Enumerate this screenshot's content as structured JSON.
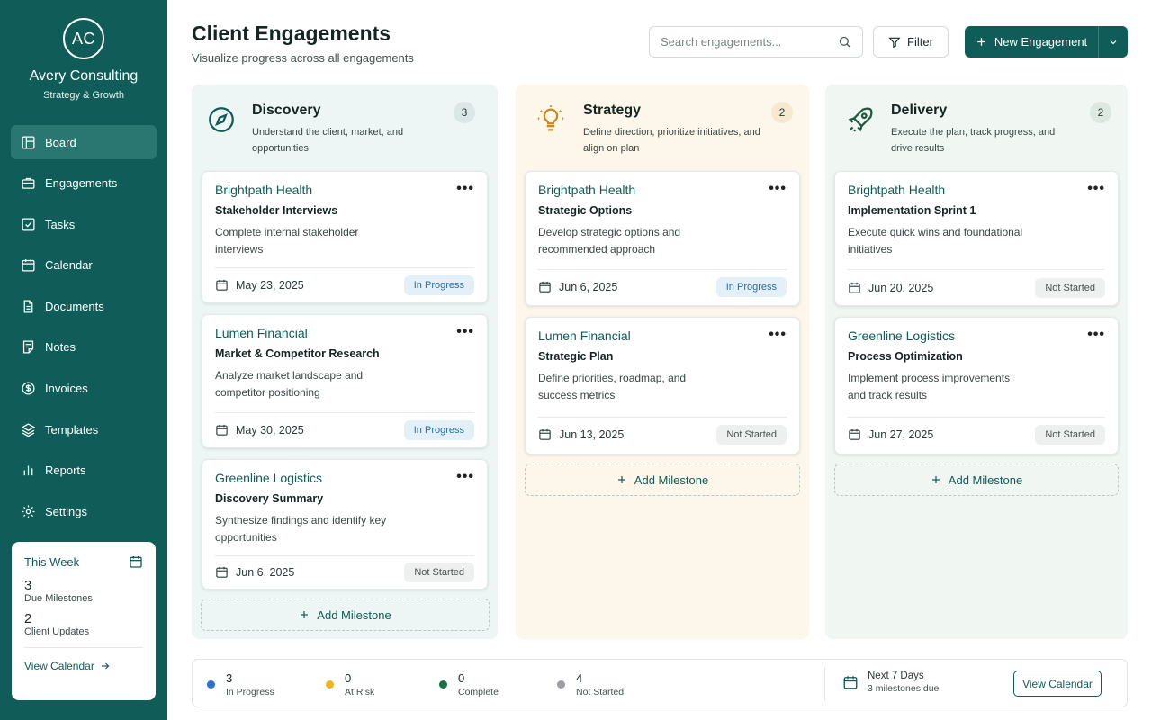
{
  "brand": {
    "initials": "AC",
    "name": "Avery Consulting",
    "tagline": "Strategy & Growth"
  },
  "nav": [
    {
      "label": "Board",
      "icon": "board-icon",
      "active": true
    },
    {
      "label": "Engagements",
      "icon": "briefcase-icon"
    },
    {
      "label": "Tasks",
      "icon": "checkbox-icon"
    },
    {
      "label": "Calendar",
      "icon": "calendar-icon"
    },
    {
      "label": "Documents",
      "icon": "document-icon"
    },
    {
      "label": "Notes",
      "icon": "notes-icon"
    },
    {
      "label": "Invoices",
      "icon": "dollar-icon"
    },
    {
      "label": "Templates",
      "icon": "layers-icon"
    },
    {
      "label": "Reports",
      "icon": "bar-chart-icon"
    },
    {
      "label": "Settings",
      "icon": "gear-icon"
    }
  ],
  "week": {
    "title": "This Week",
    "due_count": "3",
    "due_label": "Due Milestones",
    "updates_count": "2",
    "updates_label": "Client Updates",
    "link": "View Calendar"
  },
  "header": {
    "title": "Client Engagements",
    "subtitle": "Visualize progress across all engagements",
    "search_placeholder": "Search engagements...",
    "filter_label": "Filter",
    "new_label": "New Engagement"
  },
  "columns": {
    "discovery": {
      "title": "Discovery",
      "desc": "Understand the client, market, and opportunities",
      "count": "3",
      "icon": "compass-icon",
      "cards": [
        {
          "client": "Brightpath Health",
          "title": "Stakeholder Interviews",
          "desc": "Complete internal stakeholder interviews",
          "date": "May 23, 2025",
          "status": "In Progress"
        },
        {
          "client": "Lumen Financial",
          "title": "Market & Competitor Research",
          "desc": "Analyze market landscape and competitor positioning",
          "date": "May 30, 2025",
          "status": "In Progress"
        },
        {
          "client": "Greenline Logistics",
          "title": "Discovery Summary",
          "desc": "Synthesize findings and identify key opportunities",
          "date": "Jun 6, 2025",
          "status": "Not Started"
        }
      ]
    },
    "strategy": {
      "title": "Strategy",
      "desc": "Define direction, prioritize initiatives, and align on plan",
      "count": "2",
      "icon": "lightbulb-icon",
      "cards": [
        {
          "client": "Brightpath Health",
          "title": "Strategic Options",
          "desc": "Develop strategic options and recommended approach",
          "date": "Jun 6, 2025",
          "status": "In Progress"
        },
        {
          "client": "Lumen Financial",
          "title": "Strategic Plan",
          "desc": "Define priorities, roadmap, and success metrics",
          "date": "Jun 13, 2025",
          "status": "Not Started"
        }
      ]
    },
    "delivery": {
      "title": "Delivery",
      "desc": "Execute the plan, track progress, and drive results",
      "count": "2",
      "icon": "rocket-icon",
      "cards": [
        {
          "client": "Brightpath Health",
          "title": "Implementation Sprint 1",
          "desc": "Execute quick wins and foundational initiatives",
          "date": "Jun 20, 2025",
          "status": "Not Started"
        },
        {
          "client": "Greenline Logistics",
          "title": "Process Optimization",
          "desc": "Implement process improvements and track results",
          "date": "Jun 27, 2025",
          "status": "Not Started"
        }
      ]
    }
  },
  "add_milestone_label": "Add Milestone",
  "stats": [
    {
      "value": "3",
      "label": "In Progress",
      "color": "#2f6fd8"
    },
    {
      "value": "0",
      "label": "At Risk",
      "color": "#f0b429"
    },
    {
      "value": "0",
      "label": "Complete",
      "color": "#177245"
    },
    {
      "value": "4",
      "label": "Not Started",
      "color": "#9aa0a6"
    }
  ],
  "next": {
    "title": "Next 7 Days",
    "sub": "3 milestones due",
    "button": "View Calendar"
  },
  "colors": {
    "primary": "#0f5c58",
    "in_progress_bg": "#e3f0f8",
    "in_progress_text": "#2d6ca3"
  }
}
